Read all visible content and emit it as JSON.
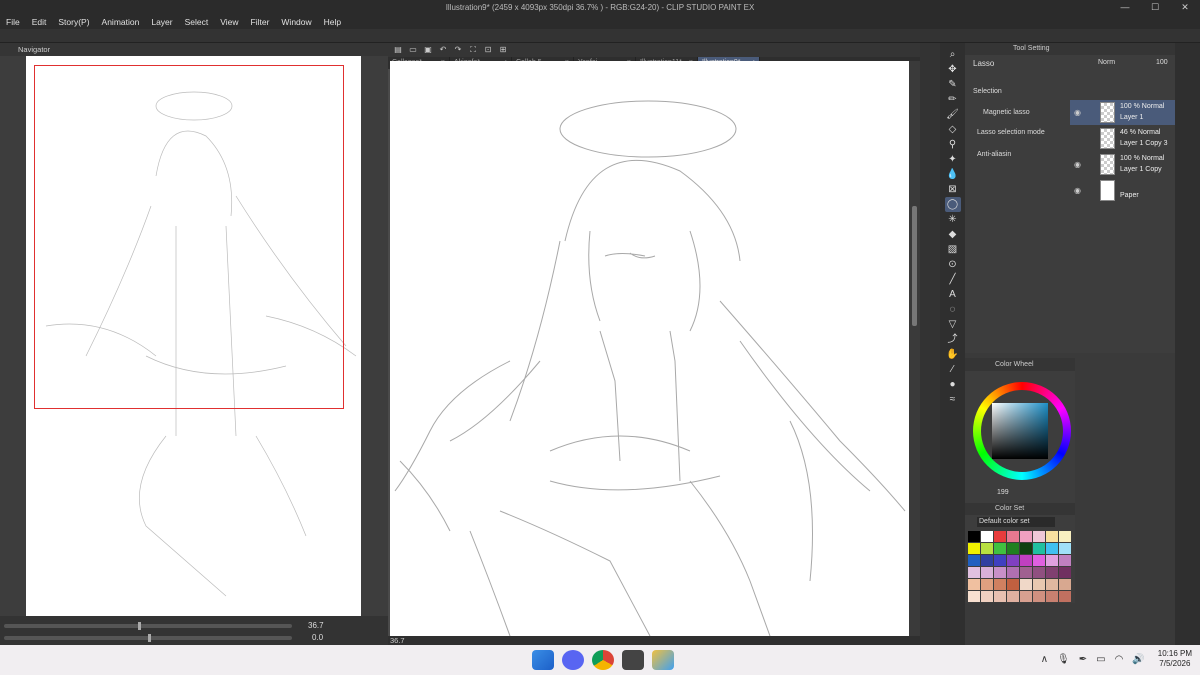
{
  "window": {
    "title": "Illustration9* (2459 x 4093px 350dpi 36.7% ) - RGB:G24-20)  - CLIP STUDIO PAINT EX"
  },
  "menu": [
    "File",
    "Edit",
    "Story(P)",
    "Animation",
    "Layer",
    "Select",
    "View",
    "Filter",
    "Window",
    "Help"
  ],
  "navigator": {
    "title": "Navigator",
    "zoom": "36.7",
    "rotation": "0.0"
  },
  "doc_tabs": [
    {
      "label": "Collapse*",
      "active": false
    },
    {
      "label": "Akigefa*",
      "active": false
    },
    {
      "label": "Collab 5",
      "active": false
    },
    {
      "label": "Yanfei",
      "active": false
    },
    {
      "label": "Illustration11*",
      "active": false
    },
    {
      "label": "Illustration9*",
      "active": true
    }
  ],
  "canvas_status": {
    "zoom": "36.7"
  },
  "tool_settings": {
    "tab": "Tool Setting",
    "tool_name": "Lasso",
    "selection_label": "Selection",
    "magnetic_lasso": "Magnetic lasso",
    "lasso_mode_label": "Lasso selection mode",
    "anti_alias_label": "Anti-aliasin"
  },
  "layer_panel": {
    "blend_select": "Norm",
    "opacity": "100",
    "layers": [
      {
        "blend": "100 % Normal",
        "name": "Layer 1",
        "active": true,
        "visible": true
      },
      {
        "blend": "46 % Normal",
        "name": "Layer 1 Copy 3",
        "active": false,
        "visible": false
      },
      {
        "blend": "100 % Normal",
        "name": "Layer 1 Copy",
        "active": false,
        "visible": true
      },
      {
        "blend": "",
        "name": "Paper",
        "active": false,
        "visible": true
      }
    ]
  },
  "color_wheel": {
    "title": "Color Wheel",
    "value": "199",
    "main_color": "#1e1e2e"
  },
  "color_set": {
    "title": "Color Set",
    "preset": "Default color set",
    "swatches": [
      "#000000",
      "#ffffff",
      "#e83c3c",
      "#e87890",
      "#f0a0c0",
      "#f0c8d8",
      "#f8e0a0",
      "#f8f0c0",
      "#f0f000",
      "#b8e040",
      "#40c040",
      "#208020",
      "#104010",
      "#20c0a0",
      "#40c0f0",
      "#a0e0f8",
      "#2060c0",
      "#3040a0",
      "#4040c0",
      "#8040c0",
      "#c040c0",
      "#e060e0",
      "#e0a0e0",
      "#c080c0",
      "#e0c0e0",
      "#d8b0d8",
      "#c890c8",
      "#b070b0",
      "#a06090",
      "#905080",
      "#804070",
      "#703060",
      "#f0c0a0",
      "#e0a080",
      "#d08060",
      "#c06040",
      "#f0d8c8",
      "#e8c8b0",
      "#e0b8a0",
      "#d8a890",
      "#f8e0d0",
      "#f0d0c0",
      "#e8c0b0",
      "#e0b0a0",
      "#d8a090",
      "#d09080",
      "#c88070",
      "#c07060"
    ]
  },
  "taskbar": {
    "time": "10:16 PM",
    "date": "7/5/2026"
  }
}
